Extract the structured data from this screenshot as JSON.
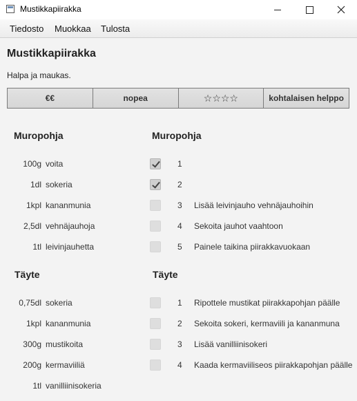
{
  "window": {
    "title": "Mustikkapiirakka"
  },
  "menu": [
    "Tiedosto",
    "Muokkaa",
    "Tulosta"
  ],
  "recipe": {
    "title": "Mustikkapiirakka",
    "description": "Halpa ja maukas.",
    "info": [
      "€€",
      "nopea",
      "☆☆☆☆",
      "kohtalaisen helppo"
    ]
  },
  "sections": [
    {
      "ingredients_title": "Muropohja",
      "steps_title": "Muropohja",
      "ingredients": [
        {
          "qty": "100g",
          "name": "voita"
        },
        {
          "qty": "1dl",
          "name": "sokeria"
        },
        {
          "qty": "1kpl",
          "name": "kananmunia"
        },
        {
          "qty": "2,5dl",
          "name": "vehnäjauhoja"
        },
        {
          "qty": "1tl",
          "name": "leivinjauhetta"
        }
      ],
      "steps": [
        {
          "num": "1",
          "text": "",
          "checked": true
        },
        {
          "num": "2",
          "text": "",
          "checked": true
        },
        {
          "num": "3",
          "text": "Lisää leivinjauho vehnäjauhoihin",
          "checked": false
        },
        {
          "num": "4",
          "text": "Sekoita jauhot vaahtoon",
          "checked": false
        },
        {
          "num": "5",
          "text": "Painele taikina piirakkavuokaan",
          "checked": false
        }
      ]
    },
    {
      "ingredients_title": "Täyte",
      "steps_title": "Täyte",
      "ingredients": [
        {
          "qty": "0,75dl",
          "name": "sokeria"
        },
        {
          "qty": "1kpl",
          "name": "kananmunia"
        },
        {
          "qty": "300g",
          "name": "mustikoita"
        },
        {
          "qty": "200g",
          "name": "kermaviiliä"
        },
        {
          "qty": "1tl",
          "name": "vanilliinisokeria"
        }
      ],
      "steps": [
        {
          "num": "1",
          "text": "Ripottele mustikat piirakkapohjan päälle",
          "checked": false
        },
        {
          "num": "2",
          "text": "Sekoita sokeri, kermaviili ja kananmuna",
          "checked": false
        },
        {
          "num": "3",
          "text": "Lisää vanilliinisokeri",
          "checked": false
        },
        {
          "num": "4",
          "text": "Kaada kermaviiliseos piirakkapohjan päälle",
          "checked": false
        }
      ]
    }
  ]
}
